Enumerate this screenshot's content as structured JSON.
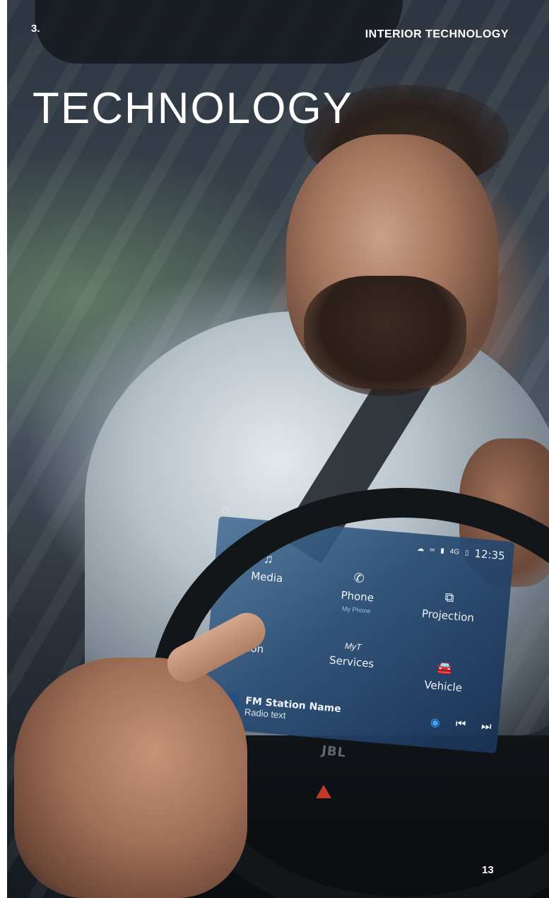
{
  "header": {
    "chapter": "3.",
    "section": "INTERIOR TECHNOLOGY"
  },
  "title": "TECHNOLOGY",
  "page_number": "13",
  "infotainment": {
    "status": {
      "icons": [
        "cloud-icon",
        "infinity-icon",
        "signal-icon",
        "battery-icon"
      ],
      "network": "4G",
      "time": "12:35"
    },
    "tiles": [
      {
        "label": "Media",
        "sublabel": "",
        "icon": "music-note-icon"
      },
      {
        "label": "Phone",
        "sublabel": "My Phone",
        "icon": "phone-icon"
      },
      {
        "label": "Projection",
        "sublabel": "",
        "icon": "projection-icon"
      },
      {
        "label": "tion",
        "sublabel": "",
        "icon": "navigation-arrow-icon"
      },
      {
        "label": "Services",
        "sublabel": "",
        "icon": "services-logo-icon",
        "logo_text": "MyT"
      },
      {
        "label": "Vehicle",
        "sublabel": "",
        "icon": "car-icon"
      }
    ],
    "now_playing": {
      "station": "FM Station Name",
      "text": "Radio text",
      "icon": "radio-broadcast-icon"
    },
    "controls": [
      "live-radio-icon",
      "previous-icon",
      "next-icon"
    ]
  },
  "brand_badge": "JBL"
}
